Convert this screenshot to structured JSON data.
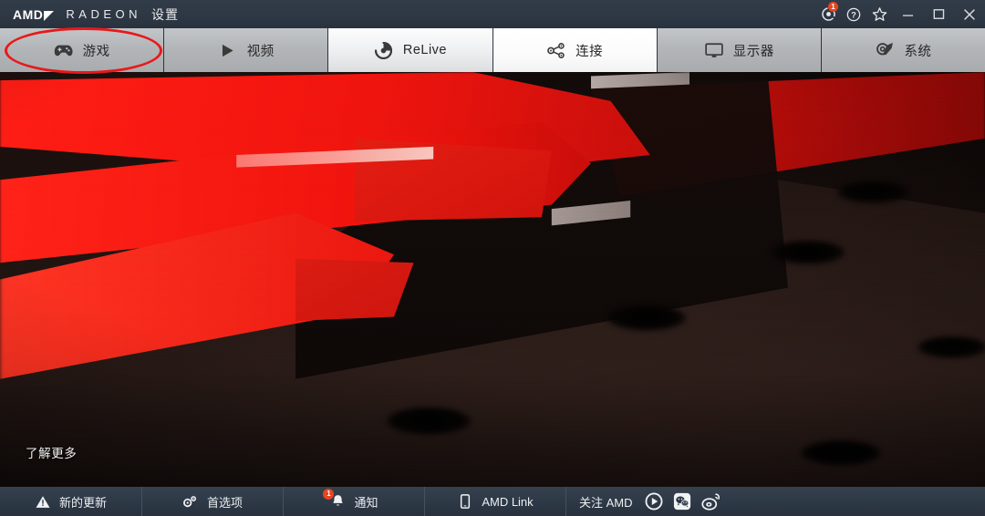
{
  "window": {
    "brand_amd": "AMD",
    "brand_radeon": "RADEON",
    "brand_settings": "设置",
    "titlebar_buttons": [
      {
        "name": "radeon-overlay-icon",
        "label": "",
        "badge": "1"
      },
      {
        "name": "help-icon",
        "label": "",
        "badge": ""
      },
      {
        "name": "favorite-star-icon",
        "label": "",
        "badge": ""
      },
      {
        "name": "minimize-button",
        "label": "",
        "badge": ""
      },
      {
        "name": "maximize-button",
        "label": "",
        "badge": ""
      },
      {
        "name": "close-button",
        "label": "",
        "badge": ""
      }
    ]
  },
  "tabs": [
    {
      "label": "游戏",
      "icon": "gamepad-icon",
      "state": "selected"
    },
    {
      "label": "视频",
      "icon": "play-icon",
      "state": "normal"
    },
    {
      "label": "ReLive",
      "icon": "relive-icon",
      "state": "light"
    },
    {
      "label": "连接",
      "icon": "connect-icon",
      "state": "hover"
    },
    {
      "label": "显示器",
      "icon": "monitor-icon",
      "state": "normal"
    },
    {
      "label": "系统",
      "icon": "system-icon",
      "state": "normal"
    }
  ],
  "main": {
    "learn_more": "了解更多",
    "hero_description": "Radeon graphics card hero image, red illuminated fins on dark shroud"
  },
  "bottom_bar": {
    "items": [
      {
        "label": "新的更新",
        "icon": "warning-triangle-icon",
        "badge": ""
      },
      {
        "label": "首选项",
        "icon": "preferences-gear-icon",
        "badge": ""
      },
      {
        "label": "通知",
        "icon": "bell-icon",
        "badge": "1"
      },
      {
        "label": "AMD Link",
        "icon": "phone-icon",
        "badge": ""
      }
    ],
    "follow_label": "关注 AMD",
    "social_icons": [
      {
        "name": "video-play-circle-icon"
      },
      {
        "name": "wechat-icon"
      },
      {
        "name": "weibo-icon"
      }
    ]
  },
  "annotation": {
    "shape": "ellipse",
    "color": "#e8191b",
    "target": "游戏"
  },
  "colors": {
    "titlebar": "#2e3845",
    "tab_default": "#b3b6b9",
    "tab_hover": "#f7f8f9",
    "bottombar": "#2e3947",
    "badge_red": "#e8441f",
    "annotation_red": "#e8191b",
    "hero_red": "#ef120c"
  }
}
